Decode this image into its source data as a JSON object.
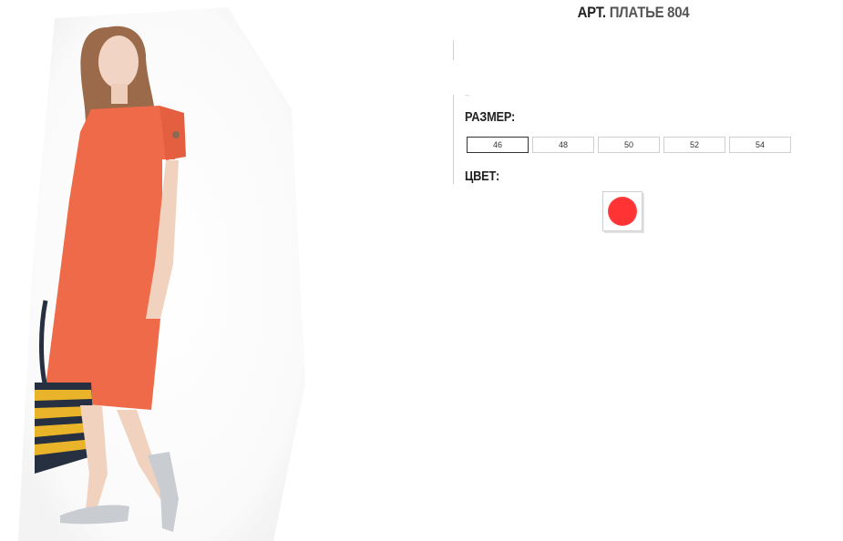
{
  "product": {
    "art_label": "АРТ.",
    "name": "ПЛАТЬЕ 804",
    "dot_text": "..",
    "size_label": "РАЗМЕР:",
    "sizes": [
      "46",
      "48",
      "50",
      "52",
      "54"
    ],
    "selected_size": "46",
    "color_label": "ЦВЕТ:",
    "color_swatch": "#ff3333",
    "dress_color": "#ef6a48"
  }
}
